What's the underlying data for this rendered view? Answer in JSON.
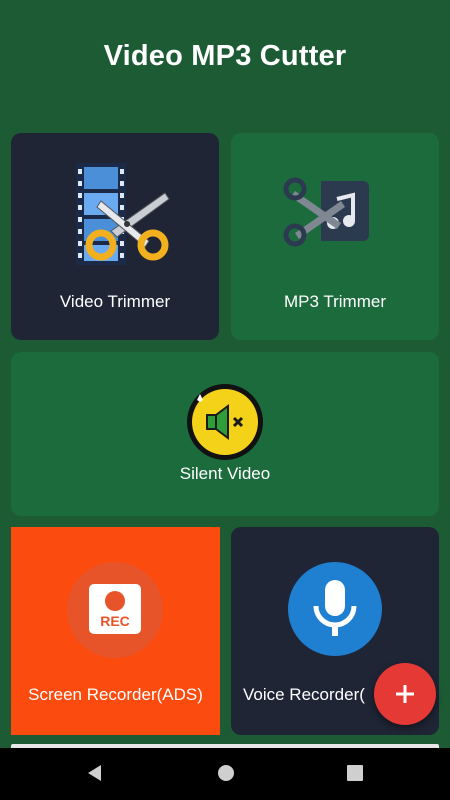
{
  "header": {
    "title": "Video MP3 Cutter"
  },
  "tiles": [
    {
      "label": "Video Trimmer",
      "icon": "film-scissors-icon",
      "bg": "#1f2535"
    },
    {
      "label": "MP3 Trimmer",
      "icon": "music-scissors-icon",
      "bg": "#1b6b3d"
    },
    {
      "label": "Silent Video",
      "icon": "mute-speaker-icon",
      "bg": "#1b6b3d"
    },
    {
      "label": "Screen Recorder(ADS)",
      "icon": "rec-icon",
      "bg": "#fb4b0f"
    },
    {
      "label": "Voice Recorder(",
      "icon": "microphone-icon",
      "bg": "#1f2535"
    }
  ],
  "fab": {
    "icon": "plus-icon",
    "color": "#e53935"
  },
  "navbar": {
    "back": "back-icon",
    "home": "home-icon",
    "recents": "recents-icon"
  }
}
